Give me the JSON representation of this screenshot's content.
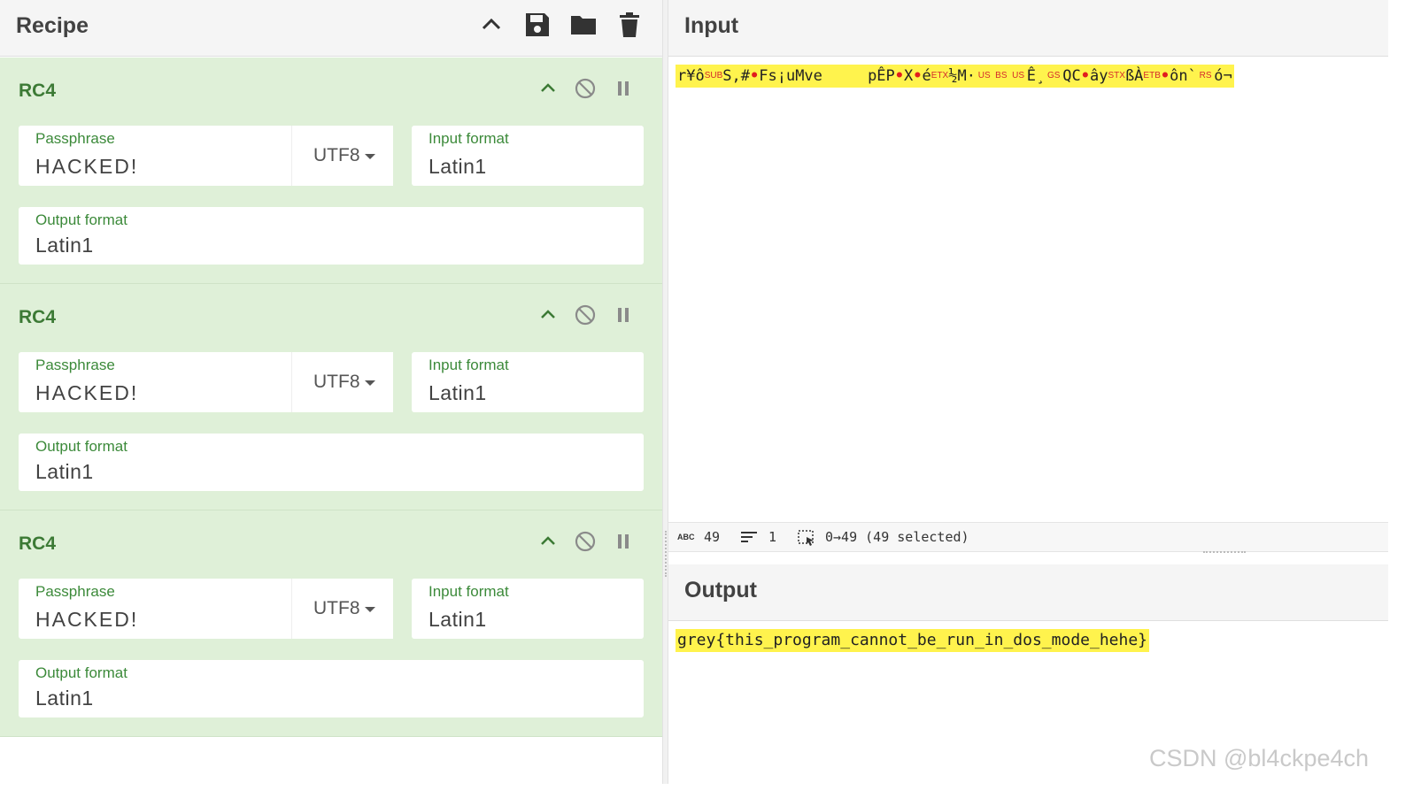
{
  "recipe": {
    "title": "Recipe",
    "icons": [
      "chevron-up-icon",
      "save-icon",
      "folder-icon",
      "trash-icon"
    ],
    "operations": [
      {
        "name": "RC4",
        "passphrase_label": "Passphrase",
        "passphrase_value": "HACKED!",
        "passphrase_encoding": "UTF8",
        "input_format_label": "Input format",
        "input_format_value": "Latin1",
        "output_format_label": "Output format",
        "output_format_value": "Latin1"
      },
      {
        "name": "RC4",
        "passphrase_label": "Passphrase",
        "passphrase_value": "HACKED!",
        "passphrase_encoding": "UTF8",
        "input_format_label": "Input format",
        "input_format_value": "Latin1",
        "output_format_label": "Output format",
        "output_format_value": "Latin1"
      },
      {
        "name": "RC4",
        "passphrase_label": "Passphrase",
        "passphrase_value": "HACKED!",
        "passphrase_encoding": "UTF8",
        "input_format_label": "Input format",
        "input_format_value": "Latin1",
        "output_format_label": "Output format",
        "output_format_value": "Latin1"
      }
    ]
  },
  "input": {
    "title": "Input",
    "segments": [
      {
        "t": "r¥ô"
      },
      {
        "c": "SUB"
      },
      {
        "t": "S,#"
      },
      {
        "d": "•"
      },
      {
        "t": "Fs¡uMve     pÊP"
      },
      {
        "d": "•"
      },
      {
        "t": "X"
      },
      {
        "d": "•"
      },
      {
        "t": "é"
      },
      {
        "c": "ETX"
      },
      {
        "t": "½M·"
      },
      {
        "c": " US "
      },
      {
        "c": " BS "
      },
      {
        "c": " US "
      },
      {
        "t": "Ê¸"
      },
      {
        "c": " GS "
      },
      {
        "t": "QC"
      },
      {
        "d": "•"
      },
      {
        "t": "ây"
      },
      {
        "c": "STX"
      },
      {
        "t": "ßÀ"
      },
      {
        "c": "ETB"
      },
      {
        "d": "•"
      },
      {
        "t": "ôn`"
      },
      {
        "c": " RS "
      },
      {
        "t": "ó¬"
      }
    ]
  },
  "status": {
    "length": "49",
    "lines": "1",
    "selection": "0→49 (49 selected)",
    "abc_label": "ABC"
  },
  "output": {
    "title": "Output",
    "text": "grey{this_program_cannot_be_run_in_dos_mode_hehe}"
  },
  "watermark": "CSDN @bl4ckpe4ch"
}
